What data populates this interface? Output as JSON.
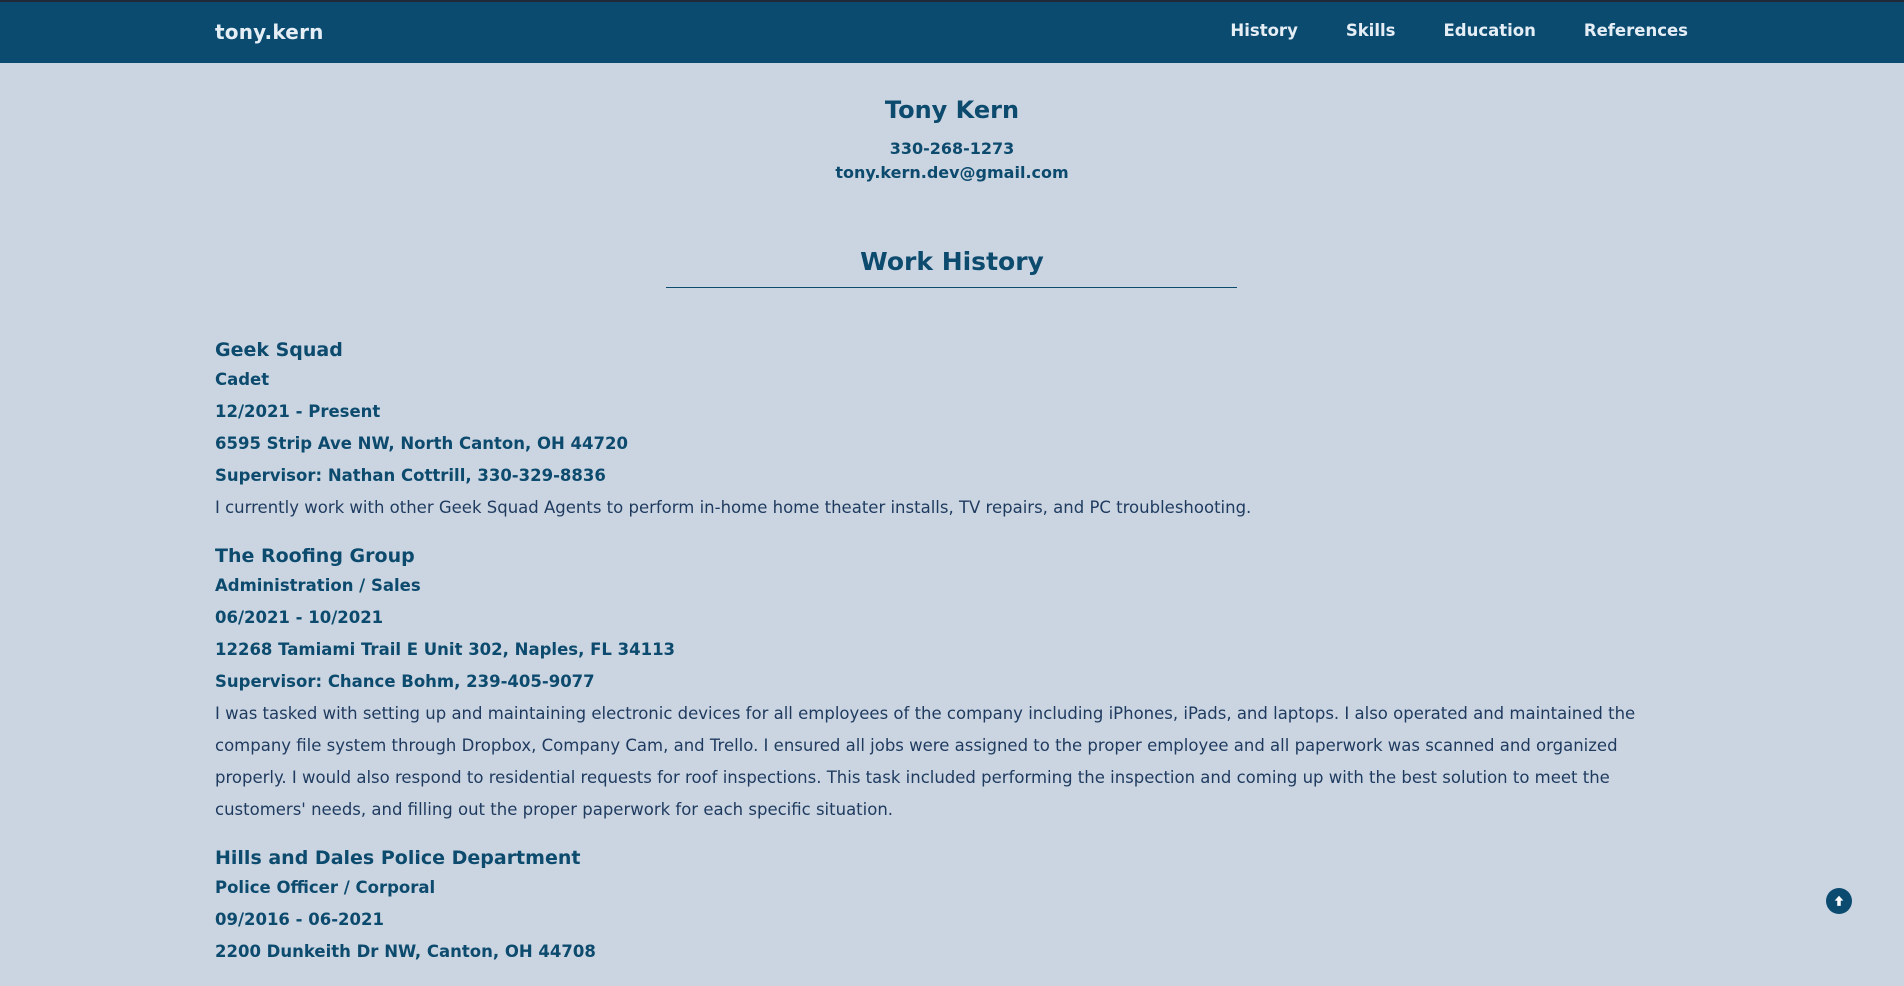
{
  "brand": "tony.kern",
  "nav": {
    "items": [
      {
        "label": "History"
      },
      {
        "label": "Skills"
      },
      {
        "label": "Education"
      },
      {
        "label": "References"
      }
    ]
  },
  "profile": {
    "name": "Tony Kern",
    "phone": "330-268-1273",
    "email": "tony.kern.dev@gmail.com"
  },
  "work_history": {
    "title": "Work History",
    "jobs": [
      {
        "company": "Geek Squad",
        "role": "Cadet",
        "dates": "12/2021 - Present",
        "address": "6595 Strip Ave NW, North Canton, OH 44720",
        "supervisor": "Supervisor: Nathan Cottrill, 330-329-8836",
        "description": "I currently work with other Geek Squad Agents to perform in-home home theater installs, TV repairs, and PC troubleshooting."
      },
      {
        "company": "The Roofing Group",
        "role": "Administration / Sales",
        "dates": "06/2021 - 10/2021",
        "address": "12268 Tamiami Trail E Unit 302, Naples, FL 34113",
        "supervisor": "Supervisor: Chance Bohm, 239-405-9077",
        "description": "I was tasked with setting up and maintaining electronic devices for all employees of the company including iPhones, iPads, and laptops. I also operated and maintained the company file system through Dropbox, Company Cam, and Trello. I ensured all jobs were assigned to the proper employee and all paperwork was scanned and organized properly. I would also respond to residential requests for roof inspections. This task included performing the inspection and coming up with the best solution to meet the customers' needs, and filling out the proper paperwork for each specific situation."
      },
      {
        "company": "Hills and Dales Police Department",
        "role": "Police Officer / Corporal",
        "dates": "09/2016 - 06-2021",
        "address": "2200 Dunkeith Dr NW, Canton, OH 44708"
      }
    ]
  },
  "icons": {
    "scroll_top": "arrow-up-circle-icon"
  },
  "colors": {
    "navbar": "#0b4b70",
    "background": "#cbd5e1",
    "text": "#0c4a6e"
  }
}
